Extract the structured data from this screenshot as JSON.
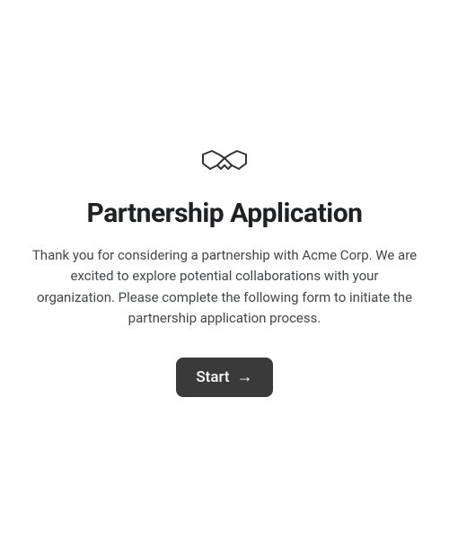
{
  "header": {
    "title": "Partnership Application"
  },
  "intro": {
    "text": "Thank you for considering a partnership with Acme Corp. We are excited to explore potential collaborations with your organization. Please complete the following form to initiate the partnership application process."
  },
  "cta": {
    "label": "Start",
    "arrow": "→"
  }
}
